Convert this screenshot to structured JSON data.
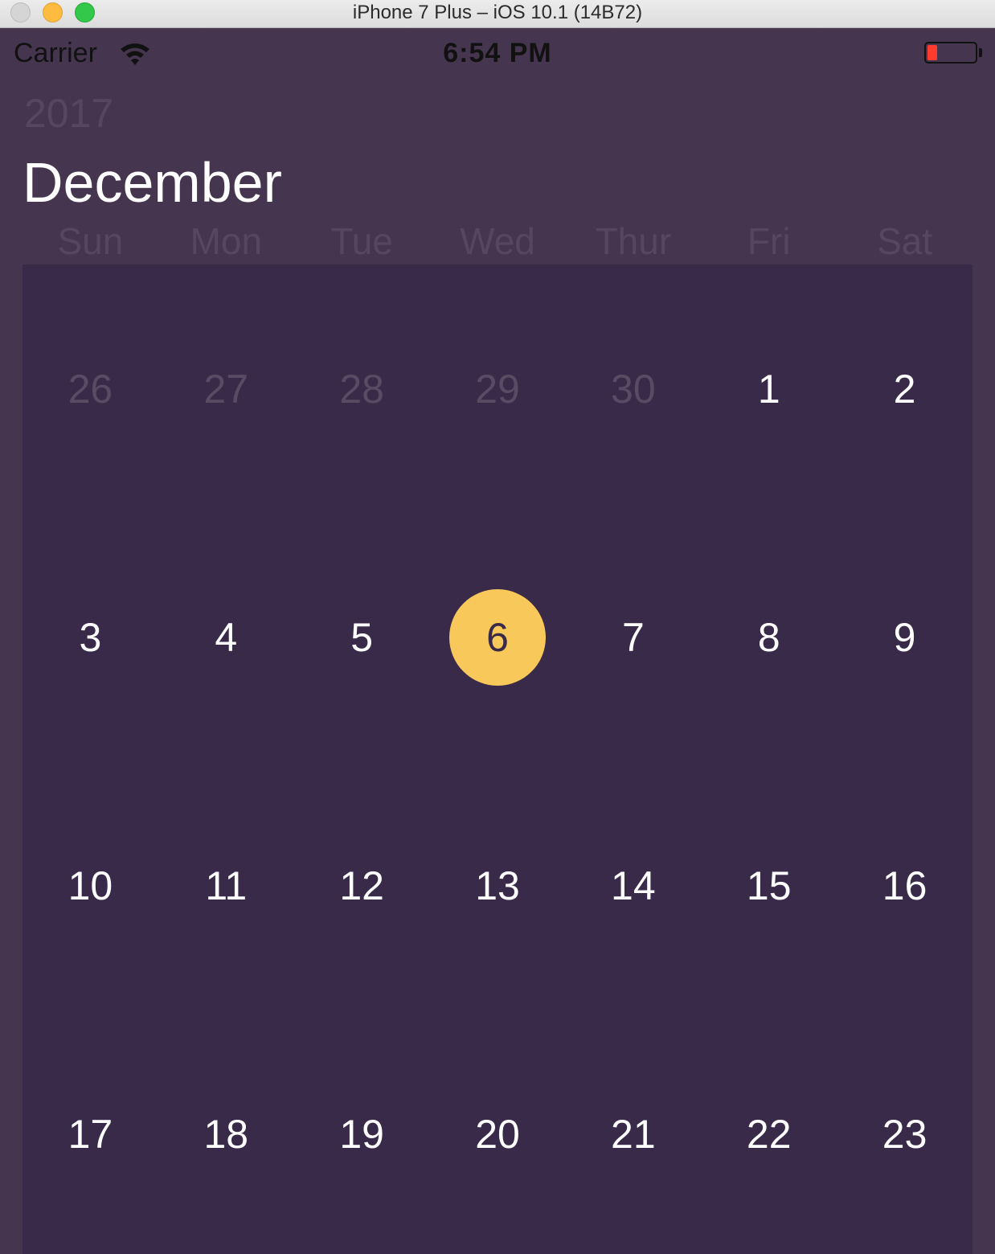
{
  "window": {
    "title": "iPhone 7 Plus – iOS 10.1 (14B72)"
  },
  "status_bar": {
    "carrier": "Carrier",
    "time": "6:54 PM",
    "battery_level": 0.2
  },
  "calendar": {
    "year": "2017",
    "month": "December",
    "weekdays": [
      "Sun",
      "Mon",
      "Tue",
      "Wed",
      "Thur",
      "Fri",
      "Sat"
    ],
    "weeks": [
      [
        {
          "day": "26",
          "in_month": false
        },
        {
          "day": "27",
          "in_month": false
        },
        {
          "day": "28",
          "in_month": false
        },
        {
          "day": "29",
          "in_month": false
        },
        {
          "day": "30",
          "in_month": false
        },
        {
          "day": "1",
          "in_month": true
        },
        {
          "day": "2",
          "in_month": true
        }
      ],
      [
        {
          "day": "3",
          "in_month": true
        },
        {
          "day": "4",
          "in_month": true
        },
        {
          "day": "5",
          "in_month": true
        },
        {
          "day": "6",
          "in_month": true,
          "selected": true
        },
        {
          "day": "7",
          "in_month": true
        },
        {
          "day": "8",
          "in_month": true
        },
        {
          "day": "9",
          "in_month": true
        }
      ],
      [
        {
          "day": "10",
          "in_month": true
        },
        {
          "day": "11",
          "in_month": true
        },
        {
          "day": "12",
          "in_month": true
        },
        {
          "day": "13",
          "in_month": true
        },
        {
          "day": "14",
          "in_month": true
        },
        {
          "day": "15",
          "in_month": true
        },
        {
          "day": "16",
          "in_month": true
        }
      ],
      [
        {
          "day": "17",
          "in_month": true
        },
        {
          "day": "18",
          "in_month": true
        },
        {
          "day": "19",
          "in_month": true
        },
        {
          "day": "20",
          "in_month": true
        },
        {
          "day": "21",
          "in_month": true
        },
        {
          "day": "22",
          "in_month": true
        },
        {
          "day": "23",
          "in_month": true
        }
      ]
    ]
  },
  "colors": {
    "background": "#46354f",
    "grid_background": "#3a2a4a",
    "selected_day": "#f8c85a",
    "muted_text": "#5a4a64",
    "battery_low": "#ff3b30"
  }
}
